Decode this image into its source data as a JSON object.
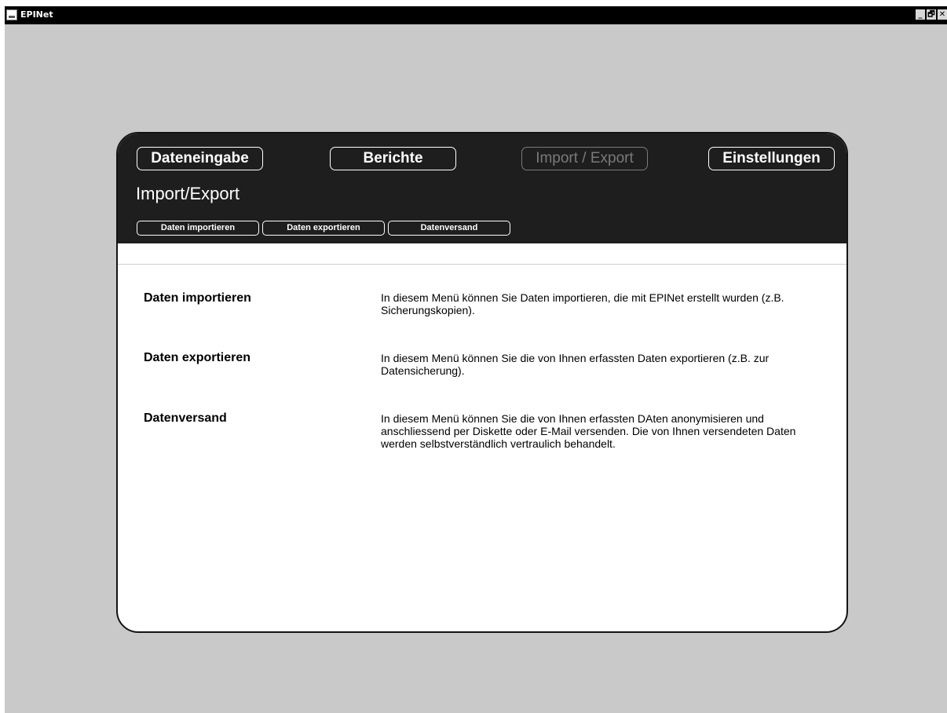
{
  "window": {
    "title": "EPINet",
    "controls": {
      "minimize": "_",
      "restore": "🗗",
      "close": "✕"
    }
  },
  "nav": {
    "dateneingabe": "Dateneingabe",
    "berichte": "Berichte",
    "import_export": "Import / Export",
    "einstellungen": "Einstellungen",
    "active": "Import / Export"
  },
  "page": {
    "heading": "Import/Export"
  },
  "subnav": {
    "importieren": "Daten importieren",
    "exportieren": "Daten exportieren",
    "versand": "Datenversand"
  },
  "items": [
    {
      "title": "Daten importieren",
      "desc": "In diesem Menü können Sie Daten importieren, die mit EPINet erstellt wurden (z.B. Sicherungskopien)."
    },
    {
      "title": "Daten exportieren",
      "desc": "In diesem Menü können Sie die von Ihnen erfassten Daten exportieren (z.B. zur Datensicherung)."
    },
    {
      "title": "Datenversand",
      "desc": "In diesem Menü können Sie die von Ihnen erfassten DAten anonymisieren und anschliessend per Diskette oder E-Mail versenden. Die von Ihnen versendeten Daten werden selbstverständlich vertraulich behandelt."
    }
  ],
  "colors": {
    "background": "#c9c9c9",
    "header": "#1e1e1e",
    "panel": "#ffffff",
    "disabled": "#7a7a7a"
  }
}
